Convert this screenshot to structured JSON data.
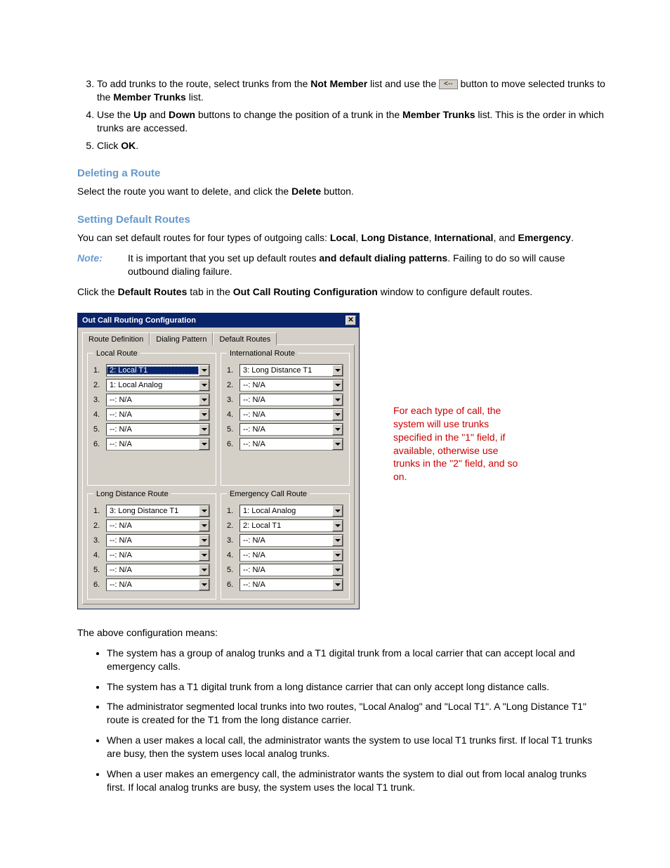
{
  "steps": {
    "s3_a": "To add trunks to the route, select trunks from the ",
    "s3_b": "Not Member",
    "s3_c": " list and use the ",
    "s3_btn": "<--",
    "s3_d": " button to move selected trunks to the ",
    "s3_e": "Member Trunks",
    "s3_f": " list.",
    "s4_a": "Use the ",
    "s4_b": "Up",
    "s4_c": " and ",
    "s4_d": "Down",
    "s4_e": " buttons to change the position of a trunk in the ",
    "s4_f": "Member Trunks",
    "s4_g": " list. This is the order in which trunks are accessed.",
    "s5_a": "Click ",
    "s5_b": "OK",
    "s5_c": "."
  },
  "sections": {
    "delete": "Deleting a Route",
    "delete_body_a": "Select the route you want to delete, and click the ",
    "delete_body_b": "Delete",
    "delete_body_c": " button.",
    "default": "Setting Default Routes",
    "default_body_a": "You can set default routes for four types of outgoing calls: ",
    "default_body_b": "Local",
    "default_body_c": ", ",
    "default_body_d": "Long Distance",
    "default_body_e": ", ",
    "default_body_f": "International",
    "default_body_g": ", and ",
    "default_body_h": "Emergency",
    "default_body_i": "."
  },
  "note": {
    "label": "Note:",
    "body_a": "It is important that you set up default routes ",
    "body_b": "and default dialing patterns",
    "body_c": ". Failing to do so will cause outbound dialing failure."
  },
  "click_line": {
    "a": "Click the ",
    "b": "Default Routes",
    "c": " tab in the ",
    "d": "Out Call Routing Configuration",
    "e": " window to configure default routes."
  },
  "dialog": {
    "title": "Out Call Routing Configuration",
    "tabs": [
      "Route Definition",
      "Dialing Pattern",
      "Default Routes"
    ],
    "groups": {
      "local": {
        "legend": "Local Route",
        "rows": [
          {
            "n": "1.",
            "v": "2: Local T1",
            "sel": true
          },
          {
            "n": "2.",
            "v": "1: Local Analog"
          },
          {
            "n": "3.",
            "v": "--: N/A"
          },
          {
            "n": "4.",
            "v": "--: N/A"
          },
          {
            "n": "5.",
            "v": "--: N/A"
          },
          {
            "n": "6.",
            "v": "--: N/A"
          }
        ]
      },
      "intl": {
        "legend": "International Route",
        "rows": [
          {
            "n": "1.",
            "v": "3: Long Distance T1"
          },
          {
            "n": "2.",
            "v": "--: N/A"
          },
          {
            "n": "3.",
            "v": "--: N/A"
          },
          {
            "n": "4.",
            "v": "--: N/A"
          },
          {
            "n": "5.",
            "v": "--: N/A"
          },
          {
            "n": "6.",
            "v": "--: N/A"
          }
        ]
      },
      "ld": {
        "legend": "Long Distance Route",
        "rows": [
          {
            "n": "1.",
            "v": "3: Long Distance T1"
          },
          {
            "n": "2.",
            "v": "--: N/A"
          },
          {
            "n": "3.",
            "v": "--: N/A"
          },
          {
            "n": "4.",
            "v": "--: N/A"
          },
          {
            "n": "5.",
            "v": "--: N/A"
          },
          {
            "n": "6.",
            "v": "--: N/A"
          }
        ]
      },
      "emerg": {
        "legend": "Emergency Call Route",
        "rows": [
          {
            "n": "1.",
            "v": "1: Local Analog"
          },
          {
            "n": "2.",
            "v": "2: Local T1"
          },
          {
            "n": "3.",
            "v": "--: N/A"
          },
          {
            "n": "4.",
            "v": "--: N/A"
          },
          {
            "n": "5.",
            "v": "--: N/A"
          },
          {
            "n": "6.",
            "v": "--: N/A"
          }
        ]
      }
    }
  },
  "callout": "For each type of call, the system will use trunks specified in the \"1\" field, if available, otherwise use trunks in the \"2\" field, and so on.",
  "explain_intro": "The above configuration means:",
  "bullets": [
    "The system has a group of analog trunks and a T1 digital trunk from a local carrier that can accept local and emergency calls.",
    "The system has a T1 digital trunk from a long distance carrier that can only accept long distance calls.",
    "The administrator segmented local trunks into two routes, \"Local Analog\" and \"Local T1\". A \"Long Distance T1\" route is created for the T1 from the long distance carrier.",
    "When a user makes a local call, the administrator wants the system to use local T1 trunks first. If local T1 trunks are busy, then the system uses local analog trunks.",
    "When a user makes an emergency call, the administrator wants the system to dial out from local analog trunks first. If local analog trunks are busy, the system uses the local T1 trunk."
  ]
}
